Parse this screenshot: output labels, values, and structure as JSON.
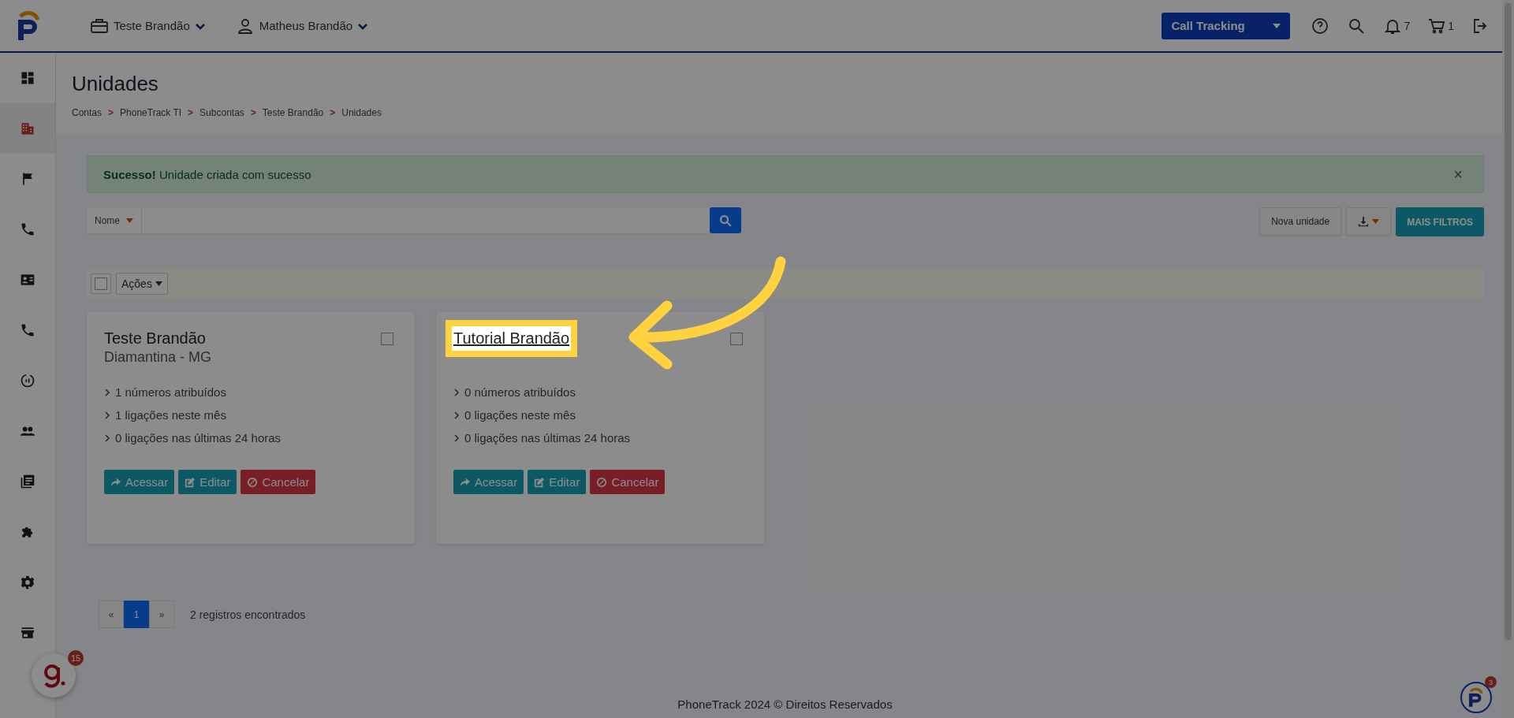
{
  "header": {
    "account": "Teste Brandão",
    "user": "Matheus Brandão",
    "product": "Call Tracking",
    "notifications": "7",
    "cart": "1"
  },
  "sidebar": {
    "items": [
      {
        "kind": "dashboard",
        "selected": false
      },
      {
        "kind": "building",
        "selected": true
      },
      {
        "kind": "flag",
        "selected": false
      },
      {
        "kind": "phone",
        "selected": false
      },
      {
        "kind": "contact",
        "selected": false
      },
      {
        "kind": "phone",
        "selected": false
      },
      {
        "kind": "target",
        "selected": false
      },
      {
        "kind": "people",
        "selected": false
      },
      {
        "kind": "library",
        "selected": false
      },
      {
        "kind": "puzzle",
        "selected": false
      },
      {
        "kind": "gear",
        "selected": false
      },
      {
        "kind": "store",
        "selected": false
      }
    ]
  },
  "page": {
    "title": "Unidades",
    "breadcrumbs": [
      {
        "label": "Contas",
        "separator": ">"
      },
      {
        "label": "PhoneTrack TI",
        "separator": ">"
      },
      {
        "label": "Subcontas",
        "separator": ">"
      },
      {
        "label": "Teste Brandão",
        "separator": ">"
      },
      {
        "label": "Unidades"
      }
    ]
  },
  "alert": {
    "strong": "Sucesso!",
    "message": "Unidade criada com sucesso",
    "close": "×"
  },
  "search": {
    "filter": "Nome"
  },
  "toolbar": {
    "new": "Nova unidade",
    "filters": "MAIS FILTROS",
    "actions": "Ações",
    "select_all_checked": false
  },
  "cards": [
    {
      "title": "Teste Brandão",
      "subtitle": "Diamantina - MG",
      "highlighted": false,
      "checked": false,
      "stats": [
        "1 números atribuídos",
        "1 ligações neste mês",
        "0 ligações nas últimas 24 horas"
      ],
      "buttons": [
        "Acessar",
        "Editar",
        "Cancelar"
      ]
    },
    {
      "title": "Tutorial Brandão",
      "highlighted": true,
      "checked": false,
      "stats": [
        "0 números atribuídos",
        "0 ligações neste mês",
        "0 ligações nas últimas 24 horas"
      ],
      "buttons": [
        "Acessar",
        "Editar",
        "Cancelar"
      ]
    }
  ],
  "pagination": {
    "pages": [
      {
        "label": "«",
        "selected": false
      },
      {
        "label": "1",
        "selected": true
      },
      {
        "label": "»",
        "selected": false
      }
    ],
    "count": "2 registros encontrados"
  },
  "footer": "PhoneTrack 2024 © Direitos Reservados",
  "chat_widget": {
    "badge": "15"
  },
  "help_widget": {
    "badge": "3"
  }
}
